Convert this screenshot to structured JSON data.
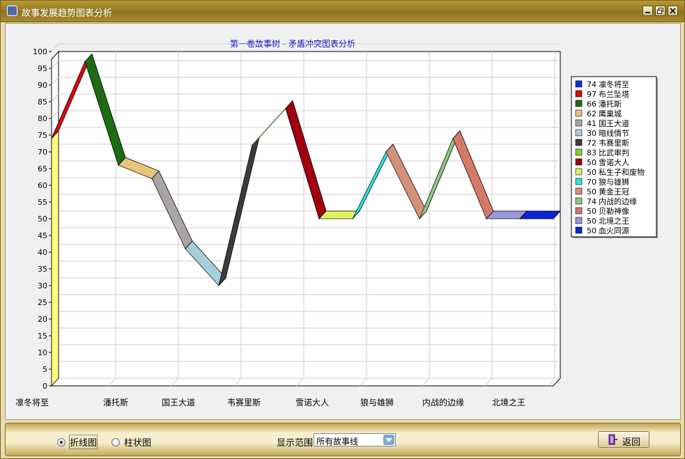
{
  "window": {
    "title": "故事发展趋势图表分析"
  },
  "chart_data": {
    "type": "line",
    "title": "第一卷故事树 - 矛盾冲突图表分析",
    "ylim": [
      0,
      100
    ],
    "y_ticks": [
      0,
      5,
      10,
      15,
      20,
      25,
      30,
      35,
      40,
      45,
      50,
      55,
      60,
      65,
      70,
      75,
      80,
      85,
      90,
      95,
      100
    ],
    "x_tick_labels": [
      "凛冬将至",
      "潘托斯",
      "国王大道",
      "韦赛里斯",
      "雪诺大人",
      "狼与雄狮",
      "内战的边缘",
      "北境之王"
    ],
    "categories": [
      "凛冬将至",
      "布兰坠塔",
      "潘托斯",
      "鹰巢城",
      "国王大道",
      "暗线情节",
      "韦赛里斯",
      "比武审判",
      "雪诺大人",
      "私生子和废物",
      "狼与雄狮",
      "黄金王冠",
      "内战的边缘",
      "贝勒神像",
      "北境之王",
      "血火同源"
    ],
    "values": [
      74,
      97,
      66,
      62,
      41,
      30,
      72,
      83,
      50,
      50,
      70,
      50,
      74,
      50,
      50,
      50
    ],
    "colors": [
      "#0a2ed8",
      "#d80c10",
      "#1f6b14",
      "#e7c67c",
      "#a9a5a6",
      "#a6cfdc",
      "#3c3c3c",
      "#86cf2d",
      "#a0000f",
      "#dff060",
      "#32e1e6",
      "#d6907a",
      "#8ec882",
      "#d37a66",
      "#9a98d8",
      "#0c25d4"
    ],
    "start_color": "#ffff80",
    "grid": true,
    "legend_position": "right"
  },
  "controls": {
    "line_label": "折线图",
    "bar_label": "柱状图",
    "range_label": "显示范围",
    "range_value": "所有故事线",
    "back_label": "返回"
  }
}
